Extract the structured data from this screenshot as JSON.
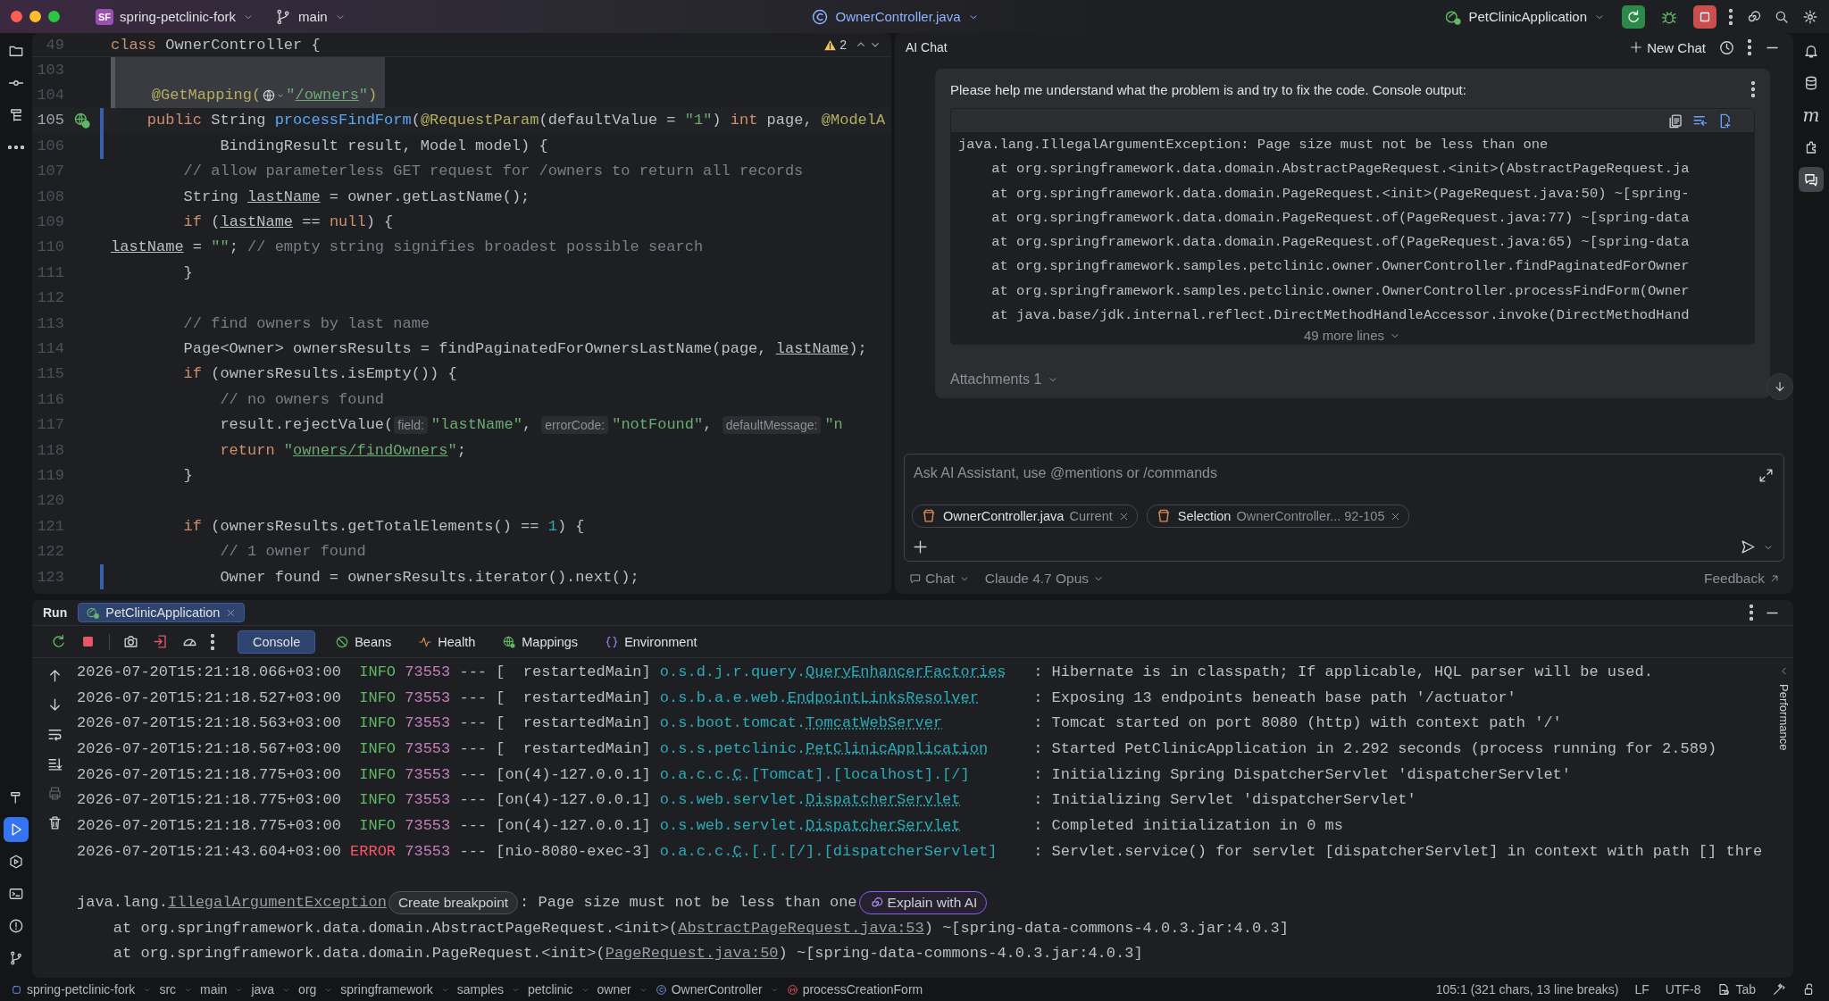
{
  "title_bar": {
    "project_badge": "SF",
    "project": "spring-petclinic-fork",
    "branch": "main",
    "file": "OwnerController.java",
    "run_config": "PetClinicApplication"
  },
  "left_toolbar": {
    "top": [
      {
        "kind": "project",
        "selected": false
      },
      {
        "kind": "commit",
        "selected": false
      },
      {
        "kind": "structure",
        "selected": false
      },
      {
        "kind": "more",
        "selected": false
      }
    ],
    "bottom": [
      {
        "kind": "build",
        "selected": false
      },
      {
        "kind": "run",
        "selected": true
      },
      {
        "kind": "services",
        "selected": false
      },
      {
        "kind": "terminal",
        "selected": false
      },
      {
        "kind": "problems",
        "selected": false
      },
      {
        "kind": "git",
        "selected": false
      }
    ]
  },
  "right_toolbar": [
    {
      "kind": "notifications",
      "selected": false
    },
    {
      "kind": "database",
      "selected": false
    },
    {
      "kind": "letter",
      "text": "m",
      "selected": false
    },
    {
      "kind": "plugin",
      "selected": false
    },
    {
      "kind": "assistant",
      "selected": true
    }
  ],
  "editor": {
    "sticky": {
      "number": "49",
      "tokens": [
        {
          "kind": "keyword",
          "text": "class"
        },
        {
          "kind": "plain",
          "text": " OwnerController {"
        }
      ]
    },
    "warning_count": "2",
    "lines": [
      {
        "number": "103",
        "kind": "preview",
        "changed": false,
        "current": false
      },
      {
        "number": "104",
        "kind": "preview",
        "changed": false,
        "current": false,
        "tokens": [
          {
            "kind": "annotation",
            "text": "    @GetMapping("
          },
          {
            "kind": "web-icon"
          },
          {
            "kind": "string",
            "text": "\""
          },
          {
            "kind": "url",
            "text": "/owners"
          },
          {
            "kind": "string",
            "text": "\""
          },
          {
            "kind": "annotation",
            "text": ")"
          }
        ]
      },
      {
        "number": "105",
        "kind": "code",
        "changed": true,
        "current": true,
        "endpoint": true,
        "tokens": [
          {
            "kind": "keyword",
            "text": "    public"
          },
          {
            "kind": "plain",
            "text": " String "
          },
          {
            "kind": "method",
            "text": "processFindForm"
          },
          {
            "kind": "plain",
            "text": "("
          },
          {
            "kind": "annotation",
            "text": "@RequestParam"
          },
          {
            "kind": "plain",
            "text": "(defaultValue = "
          },
          {
            "kind": "string",
            "text": "\"1\""
          },
          {
            "kind": "plain",
            "text": ") "
          },
          {
            "kind": "keyword",
            "text": "int"
          },
          {
            "kind": "plain",
            "text": " page, "
          },
          {
            "kind": "annotation",
            "text": "@ModelA"
          }
        ]
      },
      {
        "number": "106",
        "kind": "code",
        "changed": true,
        "current": false,
        "tokens": [
          {
            "kind": "plain",
            "text": "            BindingResult result, Model model) {"
          }
        ]
      },
      {
        "number": "107",
        "kind": "code",
        "changed": false,
        "current": false,
        "tokens": [
          {
            "kind": "comment",
            "text": "        // allow parameterless GET request for /owners to return all records"
          }
        ]
      },
      {
        "number": "108",
        "kind": "code",
        "changed": false,
        "current": false,
        "tokens": [
          {
            "kind": "plain",
            "text": "        String "
          },
          {
            "kind": "reassigned",
            "text": "lastName"
          },
          {
            "kind": "plain",
            "text": " = owner.getLastName();"
          }
        ]
      },
      {
        "number": "109",
        "kind": "code",
        "changed": false,
        "current": false,
        "tokens": [
          {
            "kind": "keyword",
            "text": "        if"
          },
          {
            "kind": "plain",
            "text": " ("
          },
          {
            "kind": "reassigned",
            "text": "lastName"
          },
          {
            "kind": "plain",
            "text": " == "
          },
          {
            "kind": "keyword",
            "text": "null"
          },
          {
            "kind": "plain",
            "text": ") {"
          }
        ]
      },
      {
        "number": "110",
        "kind": "code",
        "changed": false,
        "current": false,
        "tokens": [
          {
            "kind": "reassigned",
            "text": "            lastName"
          },
          {
            "kind": "plain",
            "text": " = "
          },
          {
            "kind": "string",
            "text": "\"\""
          },
          {
            "kind": "plain",
            "text": "; "
          },
          {
            "kind": "comment",
            "text": "// empty string signifies broadest possible search"
          }
        ]
      },
      {
        "number": "111",
        "kind": "code",
        "changed": false,
        "current": false,
        "tokens": [
          {
            "kind": "plain",
            "text": "        }"
          }
        ]
      },
      {
        "number": "112",
        "kind": "code",
        "changed": false,
        "current": false
      },
      {
        "number": "113",
        "kind": "code",
        "changed": false,
        "current": false,
        "tokens": [
          {
            "kind": "comment",
            "text": "        // find owners by last name"
          }
        ]
      },
      {
        "number": "114",
        "kind": "code",
        "changed": false,
        "current": false,
        "tokens": [
          {
            "kind": "plain",
            "text": "        Page<Owner> ownersResults = findPaginatedForOwnersLastName(page, "
          },
          {
            "kind": "reassigned",
            "text": "lastName"
          },
          {
            "kind": "plain",
            "text": ");"
          }
        ]
      },
      {
        "number": "115",
        "kind": "code",
        "changed": false,
        "current": false,
        "tokens": [
          {
            "kind": "keyword",
            "text": "        if"
          },
          {
            "kind": "plain",
            "text": " (ownersResults.isEmpty()) {"
          }
        ]
      },
      {
        "number": "116",
        "kind": "code",
        "changed": false,
        "current": false,
        "tokens": [
          {
            "kind": "comment",
            "text": "            // no owners found"
          }
        ]
      },
      {
        "number": "117",
        "kind": "code",
        "changed": false,
        "current": false,
        "tokens": [
          {
            "kind": "plain",
            "text": "            result.rejectValue("
          },
          {
            "kind": "hint",
            "text": "field:"
          },
          {
            "kind": "string",
            "text": "\"lastName\""
          },
          {
            "kind": "plain",
            "text": ", "
          },
          {
            "kind": "hint",
            "text": "errorCode:"
          },
          {
            "kind": "string",
            "text": "\"notFound\""
          },
          {
            "kind": "plain",
            "text": ", "
          },
          {
            "kind": "hint",
            "text": "defaultMessage:"
          },
          {
            "kind": "string",
            "text": "\"n"
          }
        ]
      },
      {
        "number": "118",
        "kind": "code",
        "changed": false,
        "current": false,
        "tokens": [
          {
            "kind": "keyword",
            "text": "            return"
          },
          {
            "kind": "string",
            "text": " \""
          },
          {
            "kind": "url",
            "text": "owners/findOwners"
          },
          {
            "kind": "string",
            "text": "\""
          },
          {
            "kind": "plain",
            "text": ";"
          }
        ]
      },
      {
        "number": "119",
        "kind": "code",
        "changed": false,
        "current": false,
        "tokens": [
          {
            "kind": "plain",
            "text": "        }"
          }
        ]
      },
      {
        "number": "120",
        "kind": "code",
        "changed": false,
        "current": false
      },
      {
        "number": "121",
        "kind": "code",
        "changed": false,
        "current": false,
        "tokens": [
          {
            "kind": "keyword",
            "text": "        if"
          },
          {
            "kind": "plain",
            "text": " (ownersResults.getTotalElements() == "
          },
          {
            "kind": "number",
            "text": "1"
          },
          {
            "kind": "plain",
            "text": ") {"
          }
        ]
      },
      {
        "number": "122",
        "kind": "code",
        "changed": false,
        "current": false,
        "tokens": [
          {
            "kind": "comment",
            "text": "            // 1 owner found"
          }
        ]
      },
      {
        "number": "123",
        "kind": "code",
        "changed": true,
        "current": false,
        "tokens": [
          {
            "kind": "plain",
            "text": "            Owner found = ownersResults.iterator().next();"
          }
        ]
      }
    ]
  },
  "chat": {
    "title": "AI Chat",
    "new_chat": "New Chat",
    "message": {
      "text": "Please help me understand what the problem is and try to fix the code. Console output:",
      "code": [
        "java.lang.IllegalArgumentException: Page size must not be less than one",
        "    at org.springframework.data.domain.AbstractPageRequest.<init>(AbstractPageRequest.ja",
        "    at org.springframework.data.domain.PageRequest.<init>(PageRequest.java:50) ~[spring-",
        "    at org.springframework.data.domain.PageRequest.of(PageRequest.java:77) ~[spring-data",
        "    at org.springframework.data.domain.PageRequest.of(PageRequest.java:65) ~[spring-data",
        "    at org.springframework.samples.petclinic.owner.OwnerController.findPaginatedForOwner",
        "    at org.springframework.samples.petclinic.owner.OwnerController.processFindForm(Owner",
        "    at java.base/jdk.internal.reflect.DirectMethodHandleAccessor.invoke(DirectMethodHand"
      ],
      "more": "49 more lines",
      "attachments": "Attachments 1"
    },
    "input": {
      "placeholder": "Ask AI Assistant, use @mentions or /commands",
      "chips": [
        {
          "name": "OwnerController.java",
          "detail": "Current"
        },
        {
          "name": "Selection",
          "detail": "OwnerController... 92-105"
        }
      ]
    },
    "mode": "Chat",
    "model": "Claude 4.7 Opus",
    "feedback": "Feedback"
  },
  "run_panel": {
    "title": "Run",
    "tabs": [
      {
        "label": "PetClinicApplication",
        "selected": true
      }
    ],
    "view_tabs": [
      {
        "kind": "console",
        "label": "Console",
        "selected": true
      },
      {
        "kind": "beans",
        "label": "Beans",
        "selected": false
      },
      {
        "kind": "health",
        "label": "Health",
        "selected": false
      },
      {
        "kind": "mappings",
        "label": "Mappings",
        "selected": false
      },
      {
        "kind": "environment",
        "label": "Environment",
        "selected": false
      }
    ],
    "side_tools": [
      {
        "kind": "up",
        "disabled": false
      },
      {
        "kind": "down",
        "disabled": false
      },
      {
        "kind": "wrap",
        "disabled": false
      },
      {
        "kind": "scroll-end",
        "disabled": false
      },
      {
        "kind": "print",
        "disabled": true
      },
      {
        "kind": "clear",
        "disabled": false
      }
    ],
    "log": [
      {
        "time": "2026-07-20T15:21:18.066+03:00",
        "level": "INFO",
        "pid": "73553",
        "sep": "---",
        "thread": "[  restartedMain]",
        "logger_package": "o.s.d.j.r.query.",
        "logger_class": "QueryEnhancerFactories",
        "message": ": Hibernate is in classpath; If applicable, HQL parser will be used."
      },
      {
        "time": "2026-07-20T15:21:18.527+03:00",
        "level": "INFO",
        "pid": "73553",
        "sep": "---",
        "thread": "[  restartedMain]",
        "logger_package": "o.s.b.a.e.web.",
        "logger_class": "EndpointLinksResolver",
        "message": ": Exposing 13 endpoints beneath base path '/actuator'"
      },
      {
        "time": "2026-07-20T15:21:18.563+03:00",
        "level": "INFO",
        "pid": "73553",
        "sep": "---",
        "thread": "[  restartedMain]",
        "logger_package": "o.s.boot.tomcat.",
        "logger_class": "TomcatWebServer",
        "message": ": Tomcat started on port 8080 (http) with context path '/'"
      },
      {
        "time": "2026-07-20T15:21:18.567+03:00",
        "level": "INFO",
        "pid": "73553",
        "sep": "---",
        "thread": "[  restartedMain]",
        "logger_package": "o.s.s.petclinic.",
        "logger_class": "PetClinicApplication",
        "message": ": Started PetClinicApplication in 2.292 seconds (process running for 2.589)"
      },
      {
        "time": "2026-07-20T15:21:18.775+03:00",
        "level": "INFO",
        "pid": "73553",
        "sep": "---",
        "thread": "[on(4)-127.0.0.1]",
        "logger_package": "o.a.c.c.",
        "logger_class": "C",
        "logger_rest": ".[Tomcat].[localhost].[/]",
        "message": ": Initializing Spring DispatcherServlet 'dispatcherServlet'"
      },
      {
        "time": "2026-07-20T15:21:18.775+03:00",
        "level": "INFO",
        "pid": "73553",
        "sep": "---",
        "thread": "[on(4)-127.0.0.1]",
        "logger_package": "o.s.web.servlet.",
        "logger_class": "DispatcherServlet",
        "message": ": Initializing Servlet 'dispatcherServlet'"
      },
      {
        "time": "2026-07-20T15:21:18.775+03:00",
        "level": "INFO",
        "pid": "73553",
        "sep": "---",
        "thread": "[on(4)-127.0.0.1]",
        "logger_package": "o.s.web.servlet.",
        "logger_class": "DispatcherServlet",
        "message": ": Completed initialization in 0 ms"
      },
      {
        "time": "2026-07-20T15:21:43.604+03:00",
        "level": "ERROR",
        "pid": "73553",
        "sep": "---",
        "thread": "[nio-8080-exec-3]",
        "logger_package": "o.a.c.c.",
        "logger_class": "C",
        "logger_rest": ".[.[.[/].[dispatcherServlet]",
        "message": ": Servlet.service() for servlet [dispatcherServlet] in context with path [] thre"
      }
    ],
    "exception": {
      "package": "java.lang.",
      "name": "IllegalArgumentException",
      "breakpoint_button": "Create breakpoint",
      "message": ": Page size must not be less than one",
      "explain_button": "Explain with AI"
    },
    "stack": [
      {
        "prefix": "    at org.springframework.data.domain.AbstractPageRequest.<init>(",
        "link": "AbstractPageRequest.java:53",
        "suffix": ") ~[spring-data-commons-4.0.3.jar:4.0.3]"
      },
      {
        "prefix": "    at org.springframework.data.domain.PageRequest.<init>(",
        "link": "PageRequest.java:50",
        "suffix": ") ~[spring-data-commons-4.0.3.jar:4.0.3]"
      }
    ],
    "side_tab": "Performance"
  },
  "status_bar": {
    "breadcrumbs": [
      {
        "kind": "module",
        "text": "spring-petclinic-fork"
      },
      {
        "kind": "folder",
        "text": "src"
      },
      {
        "kind": "folder",
        "text": "main"
      },
      {
        "kind": "folder",
        "text": "java"
      },
      {
        "kind": "folder",
        "text": "org"
      },
      {
        "kind": "folder",
        "text": "springframework"
      },
      {
        "kind": "folder",
        "text": "samples"
      },
      {
        "kind": "folder",
        "text": "petclinic"
      },
      {
        "kind": "folder",
        "text": "owner"
      },
      {
        "kind": "class",
        "text": "OwnerController"
      },
      {
        "kind": "method",
        "text": "processCreationForm"
      }
    ],
    "position": "105:1 (321 chars, 13 line breaks)",
    "line_separator": "LF",
    "encoding": "UTF-8",
    "indent": "Tab"
  }
}
